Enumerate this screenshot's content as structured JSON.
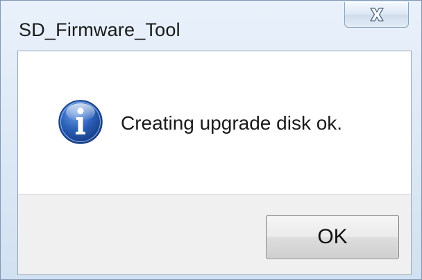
{
  "window": {
    "title": "SD_Firmware_Tool"
  },
  "titlebar": {
    "close_icon": "close-x-icon"
  },
  "dialog": {
    "icon": "information-icon",
    "message": "Creating upgrade disk ok.",
    "ok_label": "OK"
  },
  "colors": {
    "titlebar_bg": "#dce8f5",
    "info_icon_blue": "#1f56b0",
    "content_bg": "#ffffff",
    "button_area_bg": "#f0f0f0"
  }
}
